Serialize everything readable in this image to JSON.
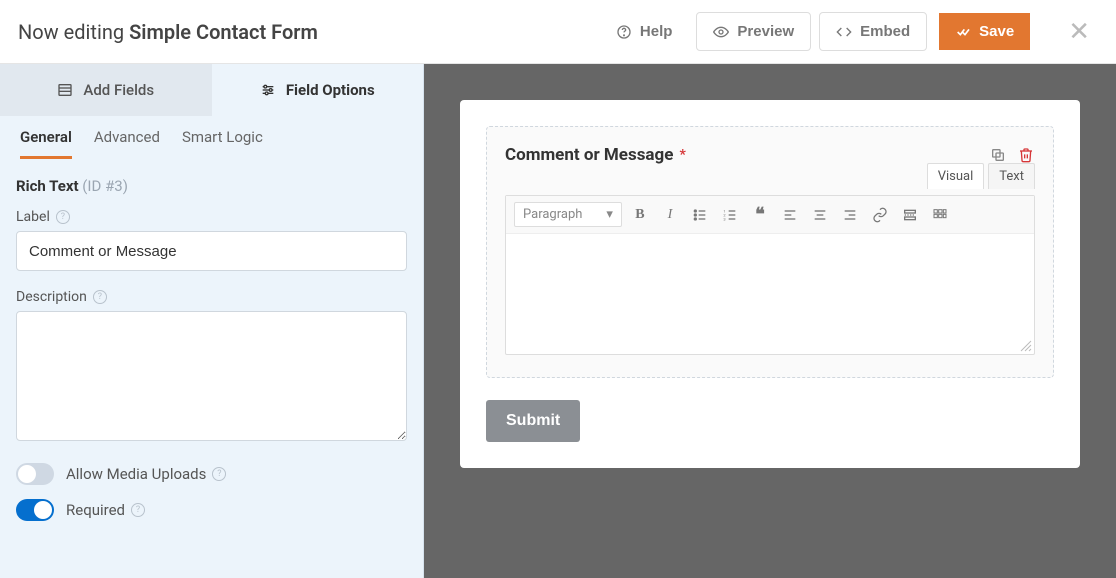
{
  "header": {
    "editing_prefix": "Now editing ",
    "form_name": "Simple Contact Form",
    "help_label": "Help",
    "preview_label": "Preview",
    "embed_label": "Embed",
    "save_label": "Save"
  },
  "sidebar": {
    "add_fields_label": "Add Fields",
    "field_options_label": "Field Options",
    "subtabs": {
      "general": "General",
      "advanced": "Advanced",
      "smart_logic": "Smart Logic"
    },
    "field": {
      "type": "Rich Text",
      "id_text": "(ID #3)",
      "label_field_label": "Label",
      "label_value": "Comment or Message",
      "description_field_label": "Description",
      "description_value": "",
      "allow_media_uploads_label": "Allow Media Uploads",
      "allow_media_uploads": false,
      "required_label": "Required",
      "required": true
    }
  },
  "preview": {
    "field_label": "Comment or Message",
    "required": true,
    "mode_visual": "Visual",
    "mode_text": "Text",
    "paragraph_dropdown": "Paragraph",
    "submit_label": "Submit"
  }
}
